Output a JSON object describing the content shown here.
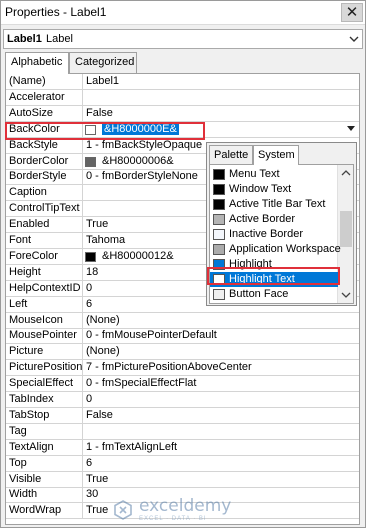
{
  "window": {
    "title": "Properties - Label1"
  },
  "object_selector": {
    "name": "Label1",
    "type": "Label"
  },
  "tabs": [
    {
      "label": "Alphabetic"
    },
    {
      "label": "Categorized"
    }
  ],
  "properties": [
    {
      "name": "(Name)",
      "value": "Label1"
    },
    {
      "name": "Accelerator",
      "value": ""
    },
    {
      "name": "AutoSize",
      "value": "False"
    },
    {
      "name": "BackColor",
      "value": "&H8000000E&",
      "swatch": "#ffffff"
    },
    {
      "name": "BackStyle",
      "value": "1 - fmBackStyleOpaque"
    },
    {
      "name": "BorderColor",
      "value": "&H80000006&",
      "swatch": "#646464"
    },
    {
      "name": "BorderStyle",
      "value": "0 - fmBorderStyleNone"
    },
    {
      "name": "Caption",
      "value": ""
    },
    {
      "name": "ControlTipText",
      "value": ""
    },
    {
      "name": "Enabled",
      "value": "True"
    },
    {
      "name": "Font",
      "value": "Tahoma"
    },
    {
      "name": "ForeColor",
      "value": "&H80000012&",
      "swatch": "#000000"
    },
    {
      "name": "Height",
      "value": "18"
    },
    {
      "name": "HelpContextID",
      "value": "0"
    },
    {
      "name": "Left",
      "value": "6"
    },
    {
      "name": "MouseIcon",
      "value": "(None)"
    },
    {
      "name": "MousePointer",
      "value": "0 - fmMousePointerDefault"
    },
    {
      "name": "Picture",
      "value": "(None)"
    },
    {
      "name": "PicturePosition",
      "value": "7 - fmPicturePositionAboveCenter"
    },
    {
      "name": "SpecialEffect",
      "value": "0 - fmSpecialEffectFlat"
    },
    {
      "name": "TabIndex",
      "value": "0"
    },
    {
      "name": "TabStop",
      "value": "False"
    },
    {
      "name": "Tag",
      "value": ""
    },
    {
      "name": "TextAlign",
      "value": "1 - fmTextAlignLeft"
    },
    {
      "name": "Top",
      "value": "6"
    },
    {
      "name": "Visible",
      "value": "True"
    },
    {
      "name": "Width",
      "value": "30"
    },
    {
      "name": "WordWrap",
      "value": "True"
    }
  ],
  "color_popup": {
    "tabs": [
      {
        "label": "Palette"
      },
      {
        "label": "System"
      }
    ],
    "active_tab": "System",
    "items": [
      {
        "label": "Menu Text",
        "color": "#000000"
      },
      {
        "label": "Window Text",
        "color": "#000000"
      },
      {
        "label": "Active Title Bar Text",
        "color": "#000000"
      },
      {
        "label": "Active Border",
        "color": "#b4b4b4"
      },
      {
        "label": "Inactive Border",
        "color": "#f4f7fc"
      },
      {
        "label": "Application Workspace",
        "color": "#ababab"
      },
      {
        "label": "Highlight",
        "color": "#0078d7"
      },
      {
        "label": "Highlight Text",
        "color": "#ffffff"
      },
      {
        "label": "Button Face",
        "color": "#f0f0f0"
      }
    ],
    "selected_item": "Highlight Text"
  },
  "watermark": {
    "name": "exceldemy",
    "tagline": "EXCEL · DATA · BI"
  },
  "colors": {
    "selection": "#0078d7",
    "callout": "#e0303a"
  }
}
